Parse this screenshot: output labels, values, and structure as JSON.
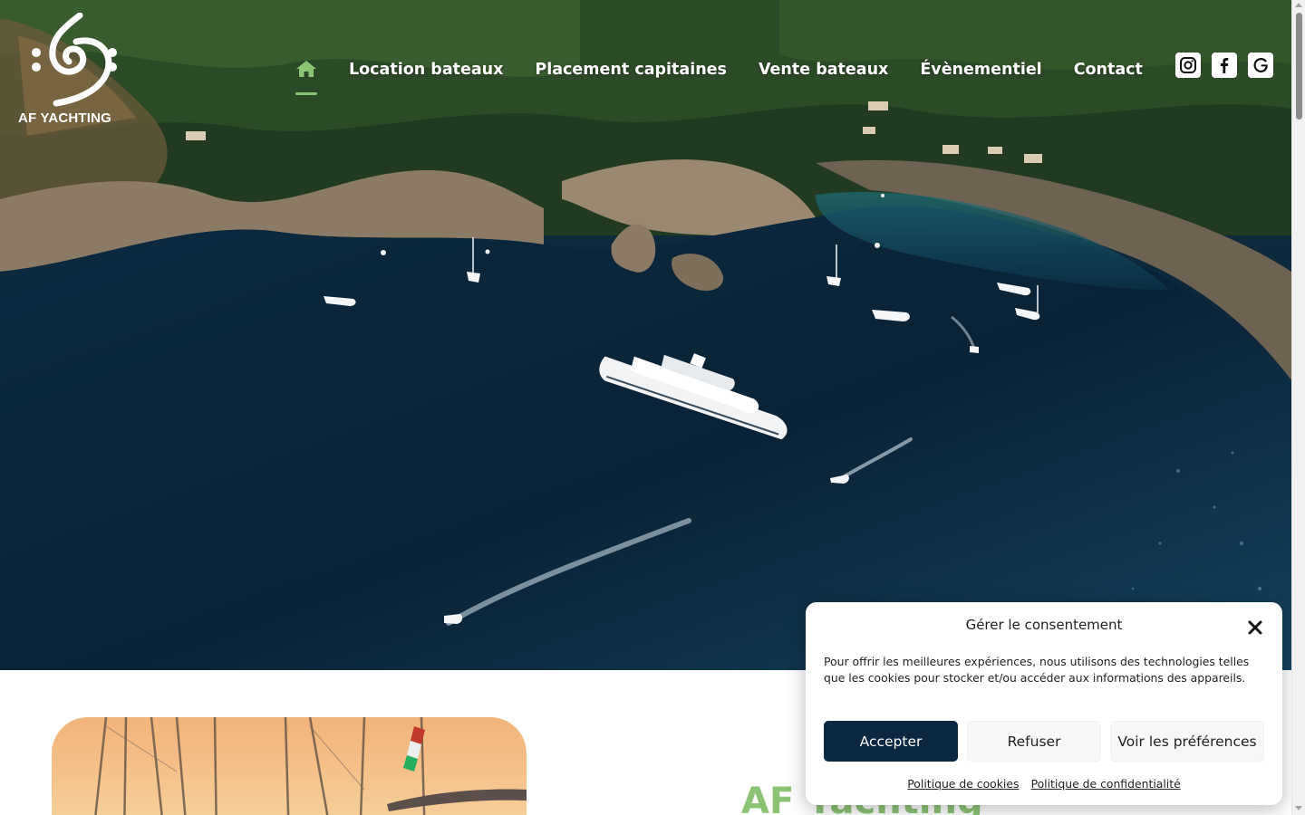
{
  "brand": {
    "name": "AF YACHTING"
  },
  "nav": {
    "home_icon": "home-icon",
    "items": [
      {
        "label": "Location bateaux"
      },
      {
        "label": "Placement capitaines"
      },
      {
        "label": "Vente bateaux"
      },
      {
        "label": "Évènementiel"
      },
      {
        "label": "Contact"
      }
    ],
    "active_color": "#8cc475"
  },
  "social": {
    "icons": [
      "instagram-icon",
      "facebook-icon",
      "google-icon"
    ]
  },
  "section": {
    "title": "AF Yachting"
  },
  "cookie_dialog": {
    "title": "Gérer le consentement",
    "text": "Pour offrir les meilleures expériences, nous utilisons des technologies telles que les cookies pour stocker et/ou accéder aux informations des appareils.",
    "accept_label": "Accepter",
    "refuse_label": "Refuser",
    "preferences_label": "Voir les préférences",
    "cookie_policy_label": "Politique de cookies",
    "privacy_policy_label": "Politique de confidentialité",
    "accent_color": "#0b2742"
  },
  "colors": {
    "brand_green": "#8cc475",
    "navy": "#0b2742"
  }
}
